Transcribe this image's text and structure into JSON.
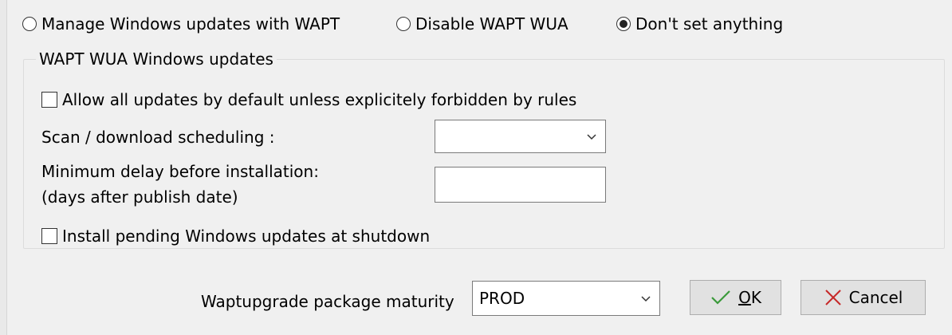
{
  "update_mode": {
    "options": [
      {
        "label": "Manage Windows updates with WAPT",
        "selected": false
      },
      {
        "label": "Disable WAPT WUA",
        "selected": false
      },
      {
        "label": "Don't set anything",
        "selected": true
      }
    ]
  },
  "wua_group": {
    "title": "WAPT WUA Windows updates",
    "allow_all_updates": {
      "label": "Allow all updates by default unless explicitely forbidden by rules",
      "checked": false
    },
    "scan_schedule": {
      "label": "Scan / download scheduling :",
      "value": ""
    },
    "min_delay": {
      "label_line1": "Minimum delay before installation:",
      "label_line2": "(days after publish date)",
      "value": ""
    },
    "install_at_shutdown": {
      "label": "Install pending Windows updates at shutdown",
      "checked": false
    }
  },
  "maturity": {
    "label": "Waptupgrade package maturity",
    "value": "PROD"
  },
  "buttons": {
    "ok_mnemonic": "O",
    "ok_rest": "K",
    "cancel": "Cancel"
  }
}
